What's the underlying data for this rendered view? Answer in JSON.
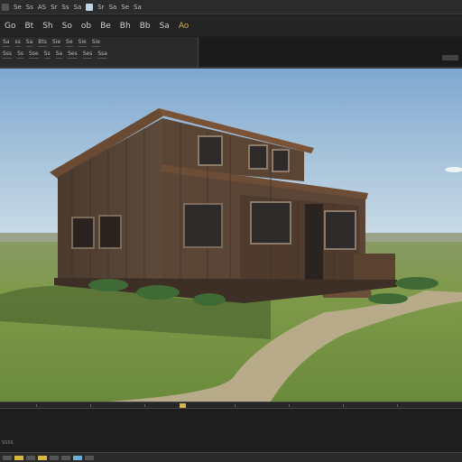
{
  "menubar": {
    "items": [
      "Se",
      "Ss",
      "AS",
      "Sr",
      "Ss",
      "Sa",
      "Sr",
      "Sa",
      "Se",
      "Sa"
    ]
  },
  "toolbar": {
    "items": [
      "Go",
      "Bt",
      "Sh",
      "So",
      "ob",
      "Be",
      "Bh",
      "Bb",
      "Sa",
      "Ao"
    ]
  },
  "panel": {
    "row1": [
      "Sa",
      "ss",
      "Sa",
      "Bts",
      "Sie",
      "Se",
      "Sie",
      "Sie"
    ],
    "row2": [
      "Sss",
      "Ss",
      "Sse",
      "Ss",
      "Sa",
      "Ses",
      "Ses",
      "Ssa"
    ]
  },
  "statusarea": {
    "label": "SSSS"
  },
  "colors": {
    "timeline_marker": "#d8b640",
    "sky_top": "#7fa8cf",
    "grass": "#7f9a4a"
  }
}
